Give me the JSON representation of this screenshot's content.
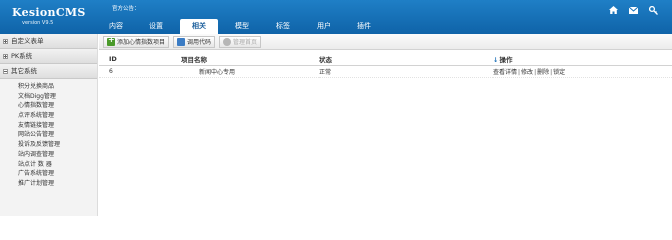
{
  "header": {
    "logo_title": "KesionCMS",
    "logo_version": "version V9.5",
    "notice": "官方公告：",
    "nav_tabs": [
      {
        "label": "内容"
      },
      {
        "label": "设置"
      },
      {
        "label": "相关",
        "active": true
      },
      {
        "label": "模型"
      },
      {
        "label": "标签"
      },
      {
        "label": "用户"
      },
      {
        "label": "插件"
      }
    ],
    "icons": [
      "home-icon",
      "mail-icon",
      "key-icon"
    ]
  },
  "sidebar": {
    "groups": [
      {
        "label": "自定义表单"
      },
      {
        "label": "PK系统"
      },
      {
        "label": "其它系统"
      }
    ],
    "items": [
      {
        "label": "积分兑换商品"
      },
      {
        "label": "文档Digg管理"
      },
      {
        "label": "心情指数管理"
      },
      {
        "label": "点评系统管理"
      },
      {
        "label": "友情链接管理"
      },
      {
        "label": "网站公告管理"
      },
      {
        "label": "投诉及反馈管理"
      },
      {
        "label": "站内调查管理"
      },
      {
        "label": "站点计 数 器"
      },
      {
        "label": "广告系统管理"
      },
      {
        "label": "推广计划管理"
      }
    ]
  },
  "toolbar": {
    "add_label": "添加心情指数项目",
    "call_label": "调用代码",
    "home_label": "管理首页"
  },
  "table": {
    "headers": {
      "id": "ID",
      "name": "项目名称",
      "status": "状态",
      "op": "操作"
    },
    "rows": [
      {
        "id": "6",
        "name": "新闻中心专用",
        "status": "正常",
        "ops": [
          "查看详情",
          "修改",
          "删除",
          "锁定"
        ]
      }
    ]
  },
  "colors": {
    "header_blue": "#1570b8",
    "sidebar_bg": "#f3f3f3"
  }
}
